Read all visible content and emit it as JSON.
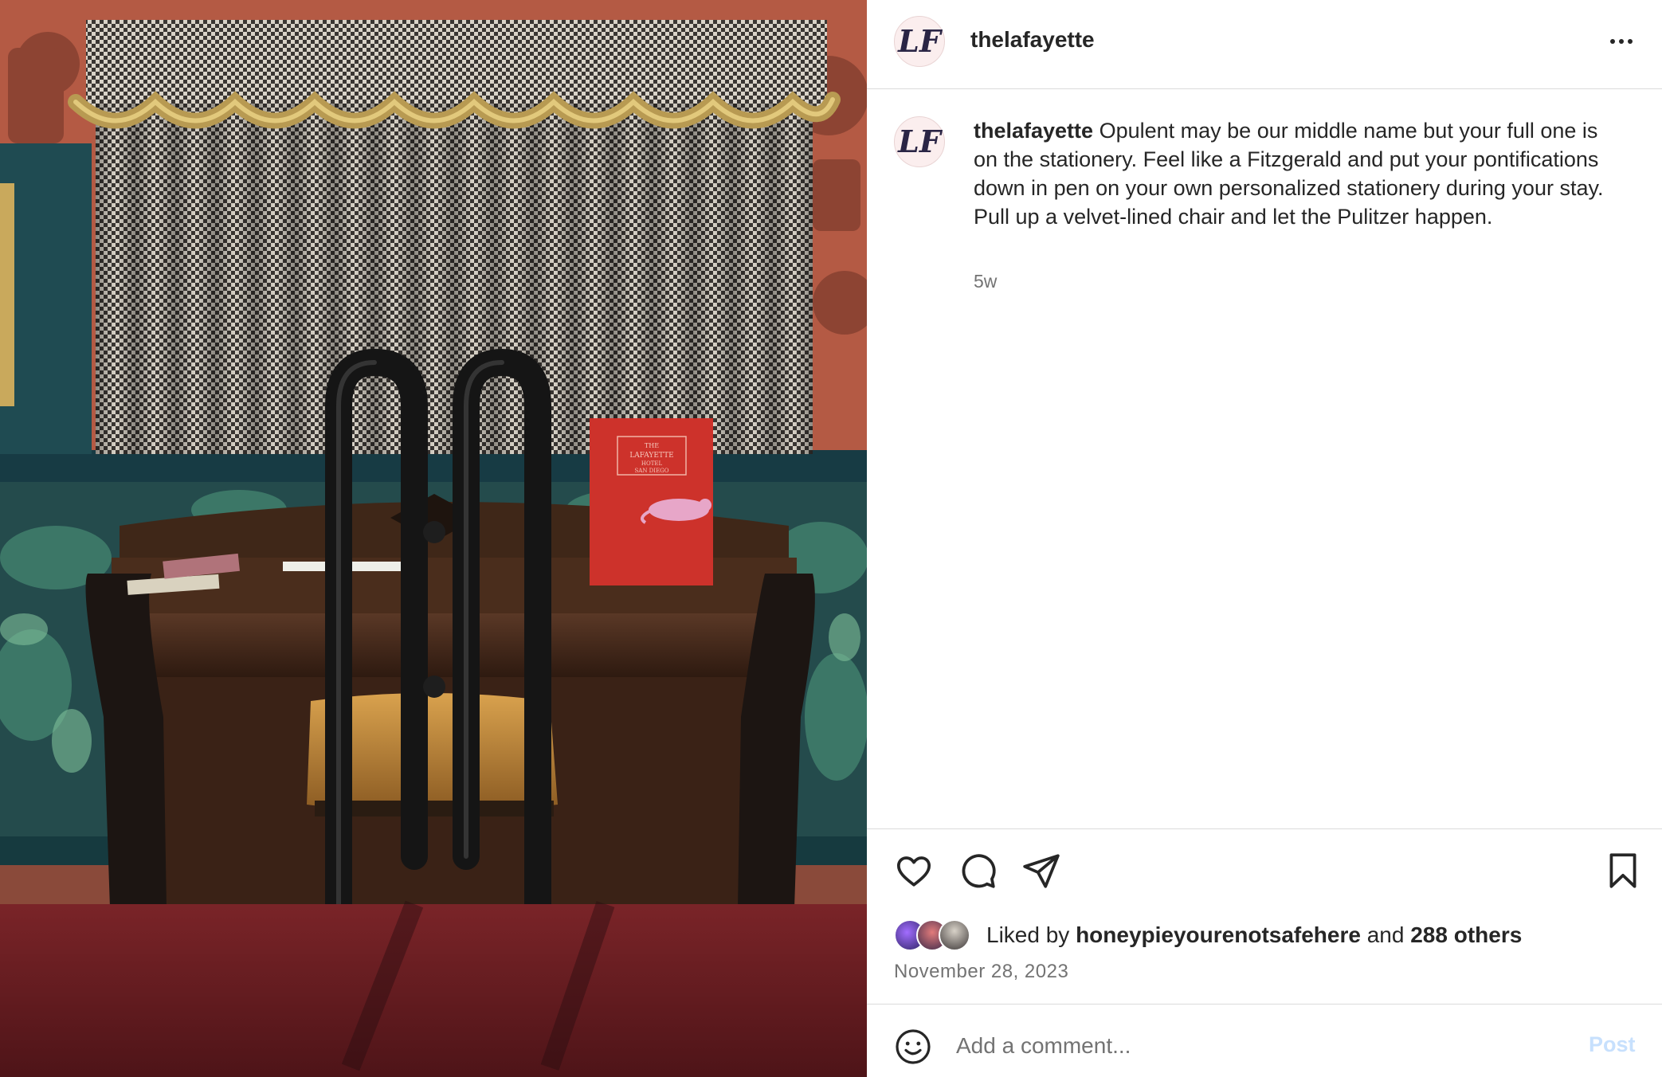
{
  "post": {
    "username": "thelafayette",
    "avatar_monogram": "LF",
    "more_icon": "more-horizontal-icon",
    "caption_text": "Opulent may be our middle name but your full one is on the stationery. Feel like a Fitzgerald and put your pontifications down in pen on your own personalized stationery during your stay. Pull up a velvet-lined chair and let the Pulitzer happen.",
    "relative_time": "5w",
    "date": "November 28, 2023"
  },
  "likes": {
    "prefix": "Liked by",
    "top_liker": "honeypieyourenotsafehere",
    "connector": "and",
    "others": "288 others"
  },
  "actions": {
    "icons": [
      "heart-icon",
      "comment-icon",
      "share-icon",
      "bookmark-icon"
    ]
  },
  "comment_box": {
    "placeholder": "Add a comment...",
    "post_label": "Post",
    "emoji_icon": "emoji-icon"
  },
  "photo": {
    "menu_lines": [
      "THE",
      "LAFAYETTE",
      "HOTEL",
      "SAN DIEGO"
    ]
  },
  "colors": {
    "text_primary": "#262626",
    "text_secondary": "#737373",
    "divider": "#dbdbdb",
    "post_button_disabled": "#c7e0fd"
  }
}
